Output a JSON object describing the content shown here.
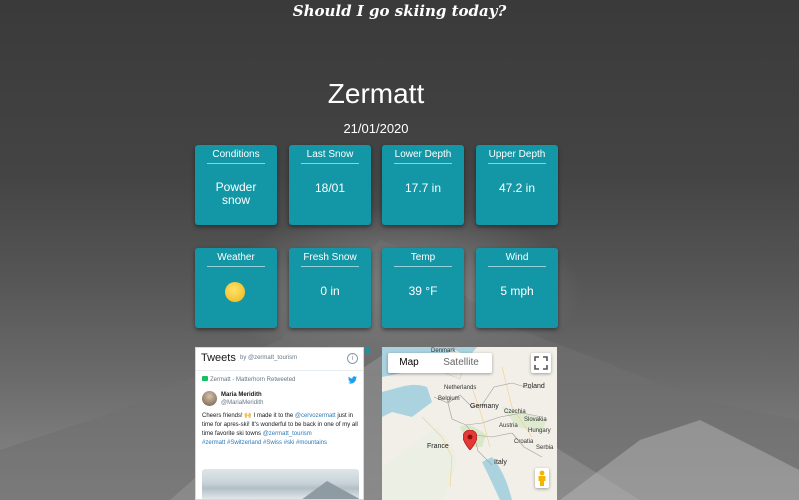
{
  "page": {
    "heading": "Should I go skiing today?"
  },
  "resort": {
    "name": "Zermatt",
    "date": "21/01/2020"
  },
  "cards_row1": [
    {
      "label": "Conditions",
      "value_line1": "Powder",
      "value_line2": "snow"
    },
    {
      "label": "Last Snow",
      "value": "18/01"
    },
    {
      "label": "Lower Depth",
      "value": "17.7 in"
    },
    {
      "label": "Upper Depth",
      "value": "47.2 in"
    }
  ],
  "cards_row2": [
    {
      "label": "Weather",
      "icon": "sun-icon"
    },
    {
      "label": "Fresh Snow",
      "value": "0 in"
    },
    {
      "label": "Temp",
      "value": "39 °F"
    },
    {
      "label": "Wind",
      "value": "5 mph"
    }
  ],
  "tweets": {
    "title": "Tweets",
    "by": "by @zermatt_tourism",
    "info": "i",
    "retweet": "Zermatt - Matterhorn Retweeted",
    "author_name": "Maria Meridith",
    "author_handle": "@MariaMeridith",
    "text_before": "Cheers friends! ",
    "emoji": "🙌",
    "text_mid": " I made it to the ",
    "mention1": "@cervozermatt",
    "text_after": " just in time for apres-ski! It's wonderful to be back in one of my all time favorite ski towns ",
    "mention2": "@zermatt_tourism",
    "tags": "#zermatt #Switzerland #Swiss #ski #mountains"
  },
  "map": {
    "tab_map": "Map",
    "tab_satellite": "Satellite",
    "labels": {
      "denmark": "Denmark",
      "netherlands": "Netherlands",
      "poland": "Poland",
      "belgium": "Belgium",
      "germany": "Germany",
      "czechia": "Czechia",
      "slovakia": "Slovakia",
      "austria": "Austria",
      "hungary": "Hungary",
      "france": "France",
      "croatia": "Croatia",
      "serbia": "Serbia",
      "italy": "Italy"
    },
    "colors": {
      "water": "#aad3df",
      "land": "#f2efe9",
      "forest": "#d8e8c8"
    }
  },
  "colors": {
    "card": "#1397a6",
    "text": "#ffffff"
  }
}
